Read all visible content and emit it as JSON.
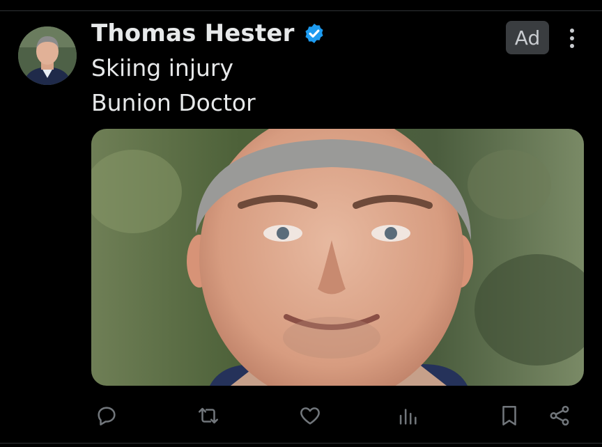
{
  "post": {
    "author_name": "Thomas Hester",
    "badge_label": "Ad",
    "lines": [
      "Skiing injury",
      "Bunion Doctor"
    ]
  },
  "icons": {
    "verified": "verified-badge-icon",
    "more": "more-vertical-icon",
    "reply": "reply-icon",
    "repost": "repost-icon",
    "like": "like-icon",
    "views": "views-icon",
    "bookmark": "bookmark-icon",
    "share": "share-icon"
  },
  "colors": {
    "background": "#000000",
    "text": "#e7e9ea",
    "verified": "#1d9bf0",
    "icon": "#71767b",
    "ad_badge": "#3a3d40"
  }
}
